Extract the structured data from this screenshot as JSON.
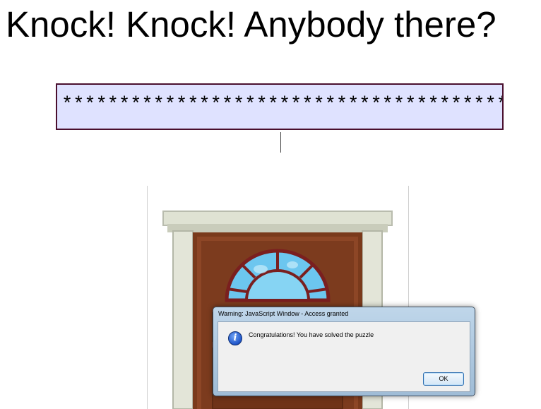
{
  "page": {
    "headline": "Knock! Knock! Anybody there?"
  },
  "password_field": {
    "value": "***************************************"
  },
  "door_image": {
    "icon": "door-icon"
  },
  "dialog": {
    "title": "Warning: JavaScript Window - Access granted",
    "message": "Congratulations! You have solved the puzzle",
    "icon": "info-icon",
    "ok_label": "OK"
  },
  "colors": {
    "field_background": "#dfe2ff",
    "field_border": "#4a0f2e",
    "door_wood": "#7a3a1c",
    "door_frame": "#d9dccd",
    "window_glass": "#6cc6ef",
    "dialog_frame": "#aecbe4"
  }
}
